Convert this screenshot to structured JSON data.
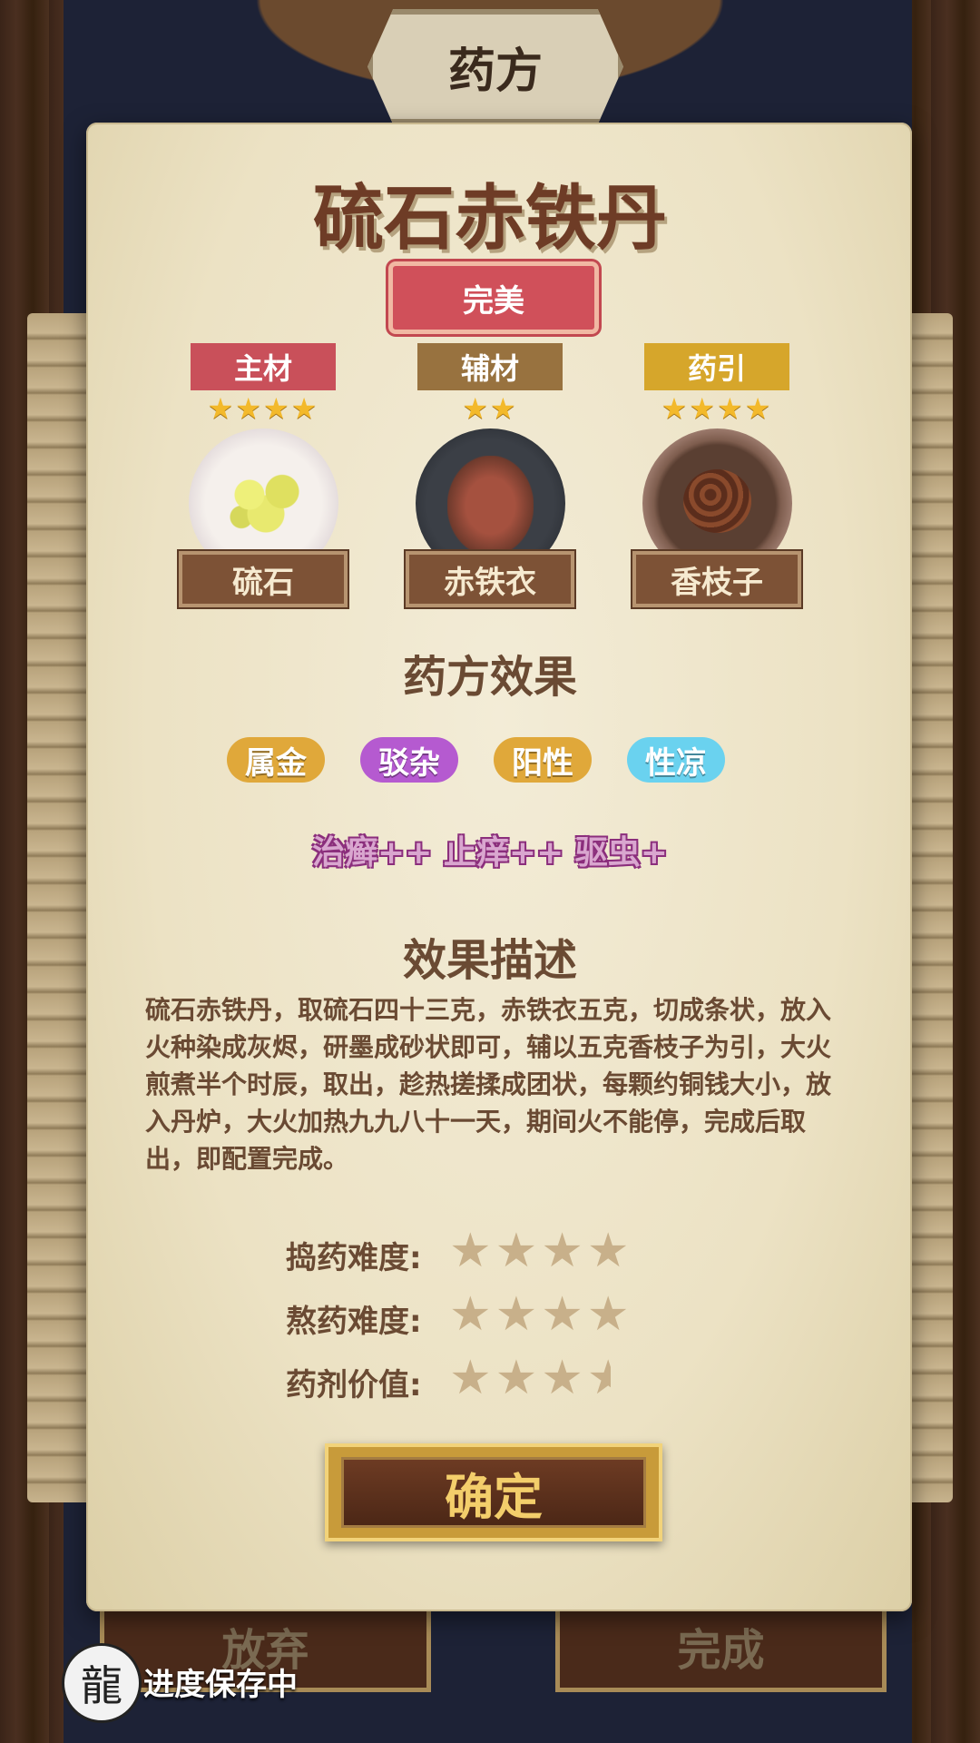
{
  "header": {
    "title": "药方"
  },
  "recipe": {
    "name": "硫石赤铁丹",
    "quality": "完美",
    "ingredients": [
      {
        "role": "主材",
        "stars": "★★★★",
        "name": "硫石",
        "color": "#c9505a"
      },
      {
        "role": "辅材",
        "stars": "★★",
        "name": "赤铁衣",
        "color": "#98723f"
      },
      {
        "role": "药引",
        "stars": "★★★★",
        "name": "香枝子",
        "color": "#d6a62b"
      }
    ]
  },
  "effects": {
    "title": "药方效果",
    "properties": [
      {
        "label": "属金",
        "color": "#e0a83a"
      },
      {
        "label": "驳杂",
        "color": "#b55ad0"
      },
      {
        "label": "阳性",
        "color": "#e0a83a"
      },
      {
        "label": "性凉",
        "color": "#6ad2ef"
      }
    ],
    "summary": "治癣++ 止痒++ 驱虫+"
  },
  "description": {
    "title": "效果描述",
    "text": "硫石赤铁丹，取硫石四十三克，赤铁衣五克，切成条状，放入火种染成灰烬，研墨成砂状即可，辅以五克香枝子为引，大火煎煮半个时辰，取出，趁热搓揉成团状，每颗约铜钱大小，放入丹炉，大火加热九九八十一天，期间火不能停，完成后取出，即配置完成。"
  },
  "ratings": [
    {
      "label": "捣药难度:",
      "value": 4,
      "max": 4
    },
    {
      "label": "熬药难度:",
      "value": 4,
      "max": 4
    },
    {
      "label": "药剂价值:",
      "value": 3.5,
      "max": 4
    }
  ],
  "buttons": {
    "confirm": "确定",
    "abandon": "放弃",
    "complete": "完成"
  },
  "status": {
    "saving": "进度保存中"
  }
}
